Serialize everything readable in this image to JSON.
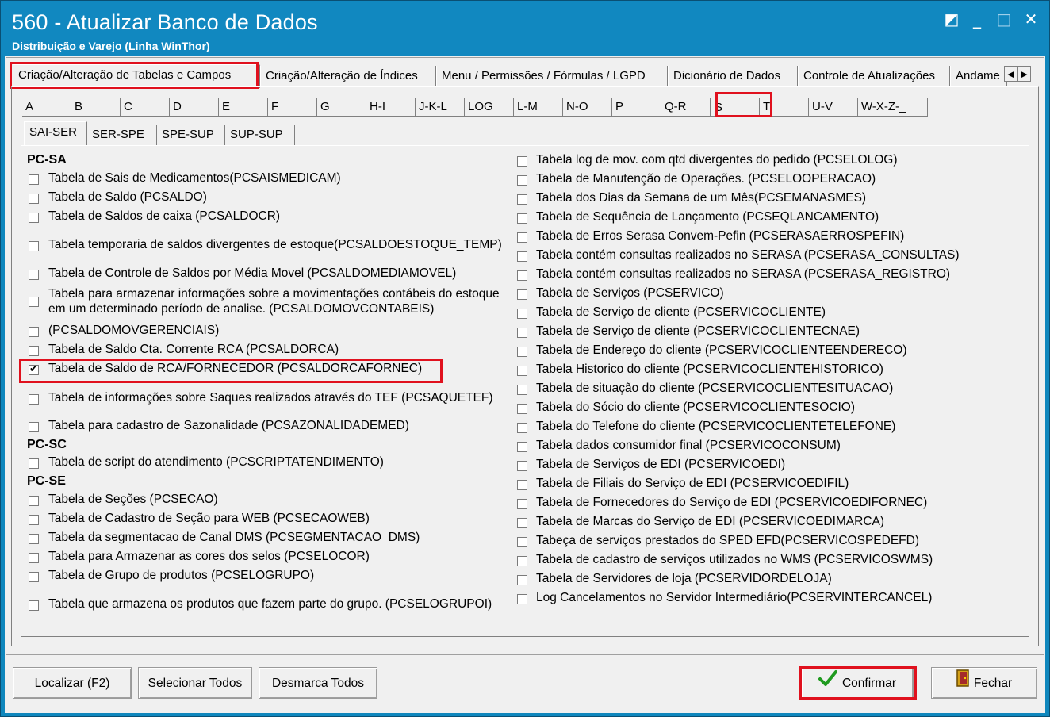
{
  "window": {
    "title": "560 - Atualizar Banco de Dados",
    "subtitle": "Distribuição e Varejo (Linha WinThor)",
    "restore_glyph": "◩",
    "minimize_glyph": "_",
    "maximize_glyph": "□",
    "close_glyph": "✕"
  },
  "main_tabs": [
    "Criação/Alteração de Tabelas e Campos",
    "Criação/Alteração de Índices",
    "Menu / Permissões / Fórmulas / LGPD",
    "Dicionário de Dados",
    "Controle de Atualizações",
    "Andame"
  ],
  "letter_tabs": [
    "A",
    "B",
    "C",
    "D",
    "E",
    "F",
    "G",
    "H-I",
    "J-K-L",
    "LOG",
    "L-M",
    "N-O",
    "P",
    "Q-R",
    "S",
    "T",
    "U-V",
    "W-X-Z-_"
  ],
  "sub_tabs": [
    "SAI-SER",
    "SER-SPE",
    "SPE-SUP",
    "SUP-SUP"
  ],
  "left_column": {
    "section_pcsa": "PC-SA",
    "section_pcsc": "PC-SC",
    "section_pcse": "PC-SE",
    "items_pcsa": [
      "Tabela de Sais de Medicamentos(PCSAISMEDICAM)",
      "Tabela de Saldo (PCSALDO)",
      "Tabela de Saldos de caixa (PCSALDOCR)",
      "Tabela temporaria de saldos divergentes de estoque(PCSALDOESTOQUE_TEMP)",
      "Tabela de Controle de Saldos por Média Movel (PCSALDOMEDIAMOVEL)",
      "Tabela para armazenar informações sobre a movimentações contábeis do estoque",
      "em um determinado período de analise. (PCSALDOMOVCONTABEIS)",
      " (PCSALDOMOVGERENCIAIS)",
      "Tabela de Saldo Cta. Corrente RCA (PCSALDORCA)",
      "Tabela de Saldo de RCA/FORNECEDOR (PCSALDORCAFORNEC)",
      "Tabela de informações sobre Saques realizados através do TEF (PCSAQUETEF)",
      "Tabela para cadastro de Sazonalidade (PCSAZONALIDADEMED)"
    ],
    "items_pcsc": [
      "Tabela de script do atendimento (PCSCRIPTATENDIMENTO)"
    ],
    "items_pcse": [
      "Tabela de Seções (PCSECAO)",
      "Tabela de Cadastro de Seção para WEB (PCSECAOWEB)",
      "Tabela da segmentacao de Canal DMS (PCSEGMENTACAO_DMS)",
      "Tabela para Armazenar as cores dos selos (PCSELOCOR)",
      "Tabela de Grupo de produtos (PCSELOGRUPO)",
      "Tabela que armazena os produtos que fazem parte do grupo. (PCSELOGRUPOI)"
    ]
  },
  "right_column": [
    "Tabela log de mov. com qtd divergentes do pedido  (PCSELOLOG)",
    "Tabela de Manutenção de Operações. (PCSELOOPERACAO)",
    "Tabela dos Dias da Semana de um Mês(PCSEMANASMES)",
    "Tabela de Sequência de Lançamento (PCSEQLANCAMENTO)",
    "Tabela de Erros Serasa Convem-Pefin (PCSERASAERROSPEFIN)",
    "Tabela contém consultas realizados no SERASA (PCSERASA_CONSULTAS)",
    "Tabela contém consultas realizados no SERASA (PCSERASA_REGISTRO)",
    "Tabela de Serviços (PCSERVICO)",
    "Tabela de Serviço de cliente (PCSERVICOCLIENTE)",
    "Tabela de Serviço de cliente (PCSERVICOCLIENTECNAE)",
    "Tabela de Endereço do cliente (PCSERVICOCLIENTEENDERECO)",
    "Tabela Historico do cliente (PCSERVICOCLIENTEHISTORICO)",
    "Tabela de situação do cliente (PCSERVICOCLIENTESITUACAO)",
    "Tabela do Sócio do cliente (PCSERVICOCLIENTESOCIO)",
    "Tabela do Telefone do cliente (PCSERVICOCLIENTETELEFONE)",
    "Tabela dados consumidor final (PCSERVICOCONSUM)",
    "Tabela de Serviços de EDI (PCSERVICOEDI)",
    "Tabela de Filiais do Serviço de EDI (PCSERVICOEDIFIL)",
    "Tabela de Fornecedores do Serviço de EDI (PCSERVICOEDIFORNEC)",
    "Tabela de Marcas do Serviço de EDI (PCSERVICOEDIMARCA)",
    "Tabeça de serviços prestados do SPED EFD(PCSERVICOSPEDEFD)",
    "Tabela de cadastro de serviços utilizados no WMS (PCSERVICOSWMS)",
    "Tabela de Servidores de loja (PCSERVIDORDELOJA)",
    "Log Cancelamentos  no Servidor Intermediário(PCSERVINTERCANCEL)"
  ],
  "buttons": {
    "localizar": "Localizar (F2)",
    "selecionar": "Selecionar Todos",
    "desmarca": "Desmarca Todos",
    "confirmar": "Confirmar",
    "fechar": "Fechar"
  },
  "colors": {
    "title_bar": "#1188c0",
    "highlight": "#e0111e",
    "confirm_check": "#1f9a1f"
  }
}
